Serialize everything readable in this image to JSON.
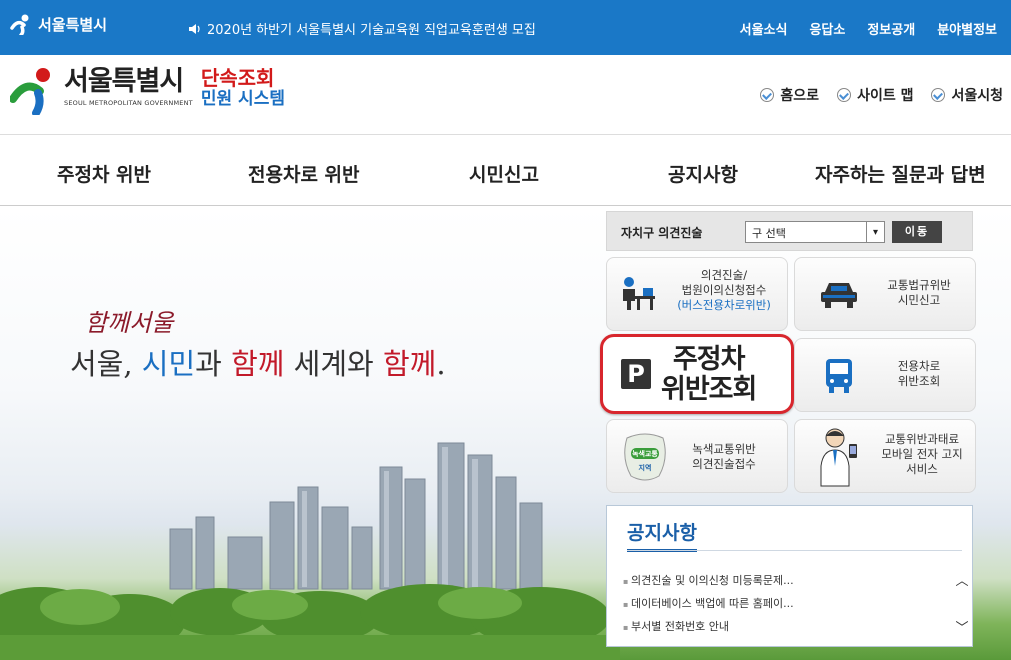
{
  "topbar": {
    "city_name": "서울특별시",
    "notice": "2020년 하반기 서울특별시 기술교육원 직업교육훈련생 모집",
    "links": [
      "서울소식",
      "응답소",
      "정보공개",
      "분야별정보"
    ]
  },
  "header": {
    "name_ko": "서울특별시",
    "name_en": "SEOUL METROPOLITAN GOVERNMENT",
    "system_line1": "단속조회",
    "system_line2": "민원 시스템",
    "util_links": [
      "홈으로",
      "사이트 맵",
      "서울시청"
    ]
  },
  "nav": {
    "items": [
      "주정차 위반",
      "전용차로 위반",
      "시민신고",
      "공지사항",
      "자주하는 질문과 답변"
    ]
  },
  "hero": {
    "sub_slogan": "함께서울",
    "slogan_parts": [
      "서울, ",
      "시민",
      "과 ",
      "함께",
      " 세계와 ",
      "함께",
      "."
    ]
  },
  "panel": {
    "opinion_label": "자치구 의견진술",
    "select_value": "구 선택",
    "go_label": "이동",
    "tiles": {
      "opinion": [
        "의견진술/",
        "법원이의신청접수",
        "(버스전용차로위반)"
      ],
      "traffic_report": [
        "교통법규위반",
        "시민신고"
      ],
      "parking_big": [
        "주정차",
        "위반조회"
      ],
      "bus_lane": [
        "전용차로",
        "위반조회"
      ],
      "green": [
        "녹색교통위반",
        "의견진술접수"
      ],
      "green_badge": [
        "녹색교통",
        "지역"
      ],
      "mobile": [
        "교통위반과태료",
        "모바일 전자 고지",
        "서비스"
      ]
    },
    "notice": {
      "title": "공지사항",
      "items": [
        "의견진술 및 이의신청 미등록문제...",
        "데이터베이스 백업에 따른 홈페이...",
        "부서별 전화번호 안내"
      ]
    }
  },
  "colors": {
    "topbar": "#1a78c7",
    "brand_red": "#d21a1a",
    "brand_blue": "#1a6fc2",
    "highlight": "#d8262d"
  }
}
